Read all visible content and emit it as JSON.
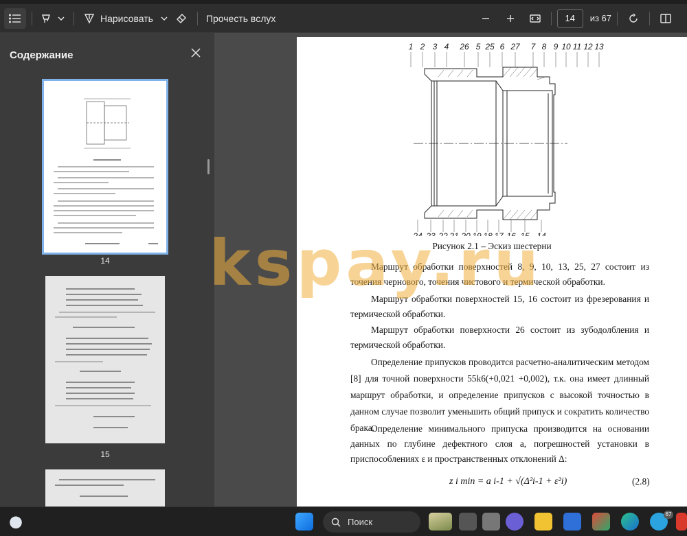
{
  "toolbar": {
    "draw_label": "Нарисовать",
    "read_aloud_label": "Прочесть вслух",
    "page_current": "14",
    "page_total": "из 67"
  },
  "sidebar": {
    "title": "Содержание",
    "pages": [
      {
        "label": "14",
        "selected": true
      },
      {
        "label": "15",
        "selected": false
      }
    ]
  },
  "document": {
    "figure_numbers_top": [
      "1",
      "2",
      "3",
      "4",
      "26",
      "5",
      "25",
      "6",
      "27",
      "7",
      "8",
      "9",
      "10",
      "11",
      "12",
      "13"
    ],
    "figure_numbers_bottom": [
      "24",
      "23",
      "22",
      "21",
      "20",
      "19",
      "18",
      "17",
      "16",
      "15",
      "14"
    ],
    "caption": "Рисунок 2.1 – Эскиз шестерни",
    "paragraphs": [
      "Маршрут обработки поверхностей 8, 9, 10, 13, 25, 27 состоит из точения чернового, точения чистового и термической обработки.",
      "Маршрут обработки поверхностей 15, 16 состоит из фрезерования и термической обработки.",
      "Маршрут обработки поверхности 26 состоит из зубодолбления и термической обработки.",
      "Определение припусков проводится расчетно-аналитическим методом [8] для точной поверхности 55k6(+0,021 +0,002), т.к. она имеет длинный маршрут обработки, и определение припусков с высокой точностью в данном случае позволит уменьшить общий припуск и сократить количество брака.",
      "Определение минимального припуска производится на основании данных по глубине дефектного слоя a, погрешностей установки в приспособлениях ε и пространственных отклонений Δ:"
    ],
    "formula": "z i min = a i-1 + √(Δ²i-1 + ε²i)",
    "formula_number": "(2.8)"
  },
  "watermark": "workspay.ru",
  "taskbar": {
    "search_label": "Поиск",
    "badge_count": "67"
  },
  "colors": {
    "accent": "#7fb3ea",
    "watermark": "#f0b03e"
  }
}
